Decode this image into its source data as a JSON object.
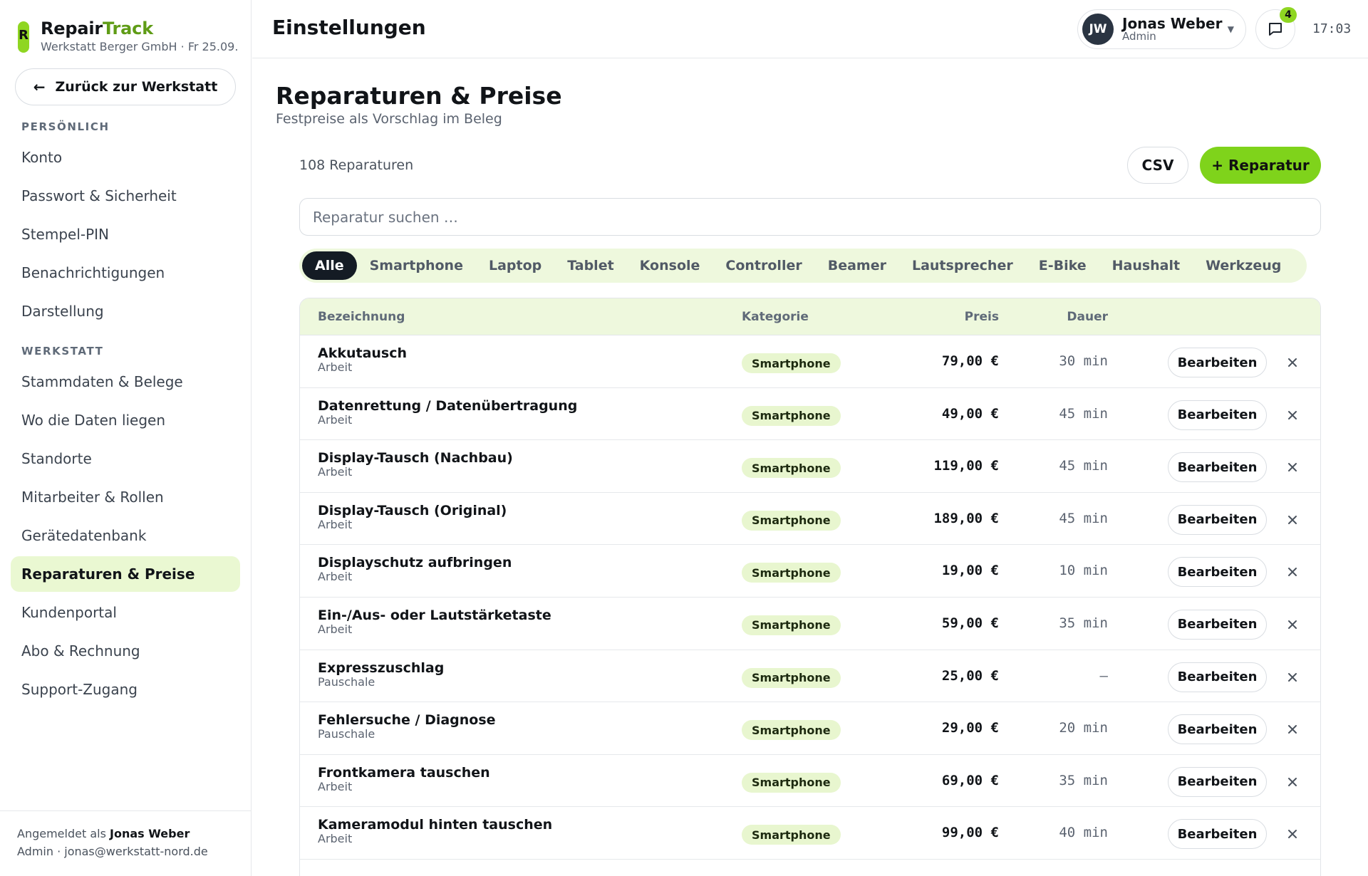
{
  "brand": {
    "logo_letter": "R",
    "name_a": "Repair",
    "name_b": "Track",
    "subtitle": "Werkstatt Berger GmbH · Fr 25.09."
  },
  "sidebar": {
    "back_label": "Zurück zur Werkstatt",
    "sections": [
      {
        "title": "PERSÖNLICH",
        "items": [
          "Konto",
          "Passwort & Sicherheit",
          "Stempel-PIN",
          "Benachrichtigungen",
          "Darstellung"
        ]
      },
      {
        "title": "WERKSTATT",
        "items": [
          "Stammdaten & Belege",
          "Wo die Daten liegen",
          "Standorte",
          "Mitarbeiter & Rollen",
          "Gerätedatenbank",
          "Reparaturen & Preise",
          "Kundenportal",
          "Abo & Rechnung",
          "Support-Zugang"
        ]
      }
    ],
    "active_item": "Reparaturen & Preise",
    "footer": {
      "logged_in_prefix": "Angemeldet als",
      "user": "Jonas Weber",
      "line2": "Admin · jonas@werkstatt-nord.de"
    }
  },
  "header": {
    "title": "Einstellungen",
    "user": {
      "initials": "JW",
      "name": "Jonas Weber",
      "role": "Admin"
    },
    "notifications": "4",
    "time": "17:03"
  },
  "main": {
    "title": "Reparaturen & Preise",
    "subtitle": "Festpreise als Vorschlag im Beleg",
    "count": "108 Reparaturen",
    "csv_label": "CSV",
    "add_label": "+ Reparatur",
    "search_placeholder": "Reparatur suchen …",
    "filters": [
      "Alle",
      "Smartphone",
      "Laptop",
      "Tablet",
      "Konsole",
      "Controller",
      "Beamer",
      "Lautsprecher",
      "E-Bike",
      "Haushalt",
      "Werkzeug"
    ],
    "active_filter": "Alle",
    "columns": {
      "name": "Bezeichnung",
      "category": "Kategorie",
      "price": "Preis",
      "duration": "Dauer"
    },
    "edit_label": "Bearbeiten",
    "rows": [
      {
        "name": "Akkutausch",
        "type": "Arbeit",
        "category": "Smartphone",
        "price": "79,00 €",
        "duration": "30 min"
      },
      {
        "name": "Datenrettung / Datenübertragung",
        "type": "Arbeit",
        "category": "Smartphone",
        "price": "49,00 €",
        "duration": "45 min"
      },
      {
        "name": "Display-Tausch (Nachbau)",
        "type": "Arbeit",
        "category": "Smartphone",
        "price": "119,00 €",
        "duration": "45 min"
      },
      {
        "name": "Display-Tausch (Original)",
        "type": "Arbeit",
        "category": "Smartphone",
        "price": "189,00 €",
        "duration": "45 min"
      },
      {
        "name": "Displayschutz aufbringen",
        "type": "Arbeit",
        "category": "Smartphone",
        "price": "19,00 €",
        "duration": "10 min"
      },
      {
        "name": "Ein-/Aus- oder Lautstärketaste",
        "type": "Arbeit",
        "category": "Smartphone",
        "price": "59,00 €",
        "duration": "35 min"
      },
      {
        "name": "Expresszuschlag",
        "type": "Pauschale",
        "category": "Smartphone",
        "price": "25,00 €",
        "duration": "–"
      },
      {
        "name": "Fehlersuche / Diagnose",
        "type": "Pauschale",
        "category": "Smartphone",
        "price": "29,00 €",
        "duration": "20 min"
      },
      {
        "name": "Frontkamera tauschen",
        "type": "Arbeit",
        "category": "Smartphone",
        "price": "69,00 €",
        "duration": "35 min"
      },
      {
        "name": "Kameramodul hinten tauschen",
        "type": "Arbeit",
        "category": "Smartphone",
        "price": "99,00 €",
        "duration": "40 min"
      }
    ]
  },
  "colors": {
    "accent": "#7fd31b",
    "accent_soft": "#eaf8d2",
    "dark": "#141b24"
  }
}
